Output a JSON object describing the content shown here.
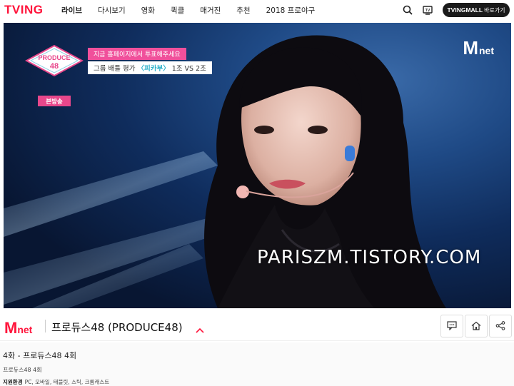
{
  "header": {
    "logo": "TVING",
    "nav": [
      "라이브",
      "다시보기",
      "영화",
      "퀵클",
      "매거진",
      "추천",
      "2018 프로야구"
    ],
    "mall_button": {
      "brand": "TVINGMALL",
      "label": "바로가기"
    },
    "icons": [
      "search-icon",
      "tv-icon"
    ]
  },
  "video": {
    "show_logo": "PRODUCE 48",
    "live_tag": "본방송",
    "caption_line1": "지금 홈페이지에서 투표해주세요",
    "caption_line2_pre": "그룹 배틀 평가 ",
    "caption_line2_song": "〈피카부〉",
    "caption_line2_post": " 1조 VS 2조",
    "channel_mark_m": "M",
    "channel_mark_net": "net",
    "watermark": "PARISZM.TISTORY.COM"
  },
  "channel": {
    "logo_m": "M",
    "logo_net": "net",
    "program_title": "프로듀스48 (PRODUCE48)",
    "actions": [
      "comment-icon",
      "home-icon",
      "share-icon"
    ]
  },
  "episode": {
    "title": "4화 - 프로듀스48 4회",
    "subtitle": "프로듀스48 4회",
    "env_label": "지원환경",
    "env_value": "PC, 모바일, 태블릿, 스틱, 크롬캐스트"
  },
  "colors": {
    "brand": "#ff153c",
    "caption_pink": "#f0509b",
    "song_teal": "#2ab0c9"
  }
}
